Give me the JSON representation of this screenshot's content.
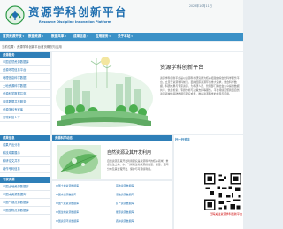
{
  "header": {
    "title": "资源学科创新平台",
    "subtitle": "Resource Discipline Innovation Platform",
    "date": "2023年10月11日"
  },
  "nav": [
    "首页资源开放",
    "数据资源",
    "数据共享",
    "成果信息",
    "应用服务",
    "关于本站"
  ],
  "breadcrumb": "当前位置：资源学科创新平台首页概况与应用",
  "sidebar": {
    "heading": "资源服务",
    "items": [
      "中国自然资源数据库",
      "资源环境信息平台",
      "地理信息科学数据",
      "土地资源科学数据",
      "资源科学数据共享",
      "遥感数据共享服务",
      "资源学科专家库",
      "高端科技人才"
    ],
    "heading2": "成果信息",
    "items2": [
      "成果产出分析",
      "科技成果展示",
      "科研论文共享",
      "著作专利信息",
      "人才培养情况"
    ],
    "heading3": "专家资源",
    "items3": [
      "中国土地资源数据库",
      "中国水资源数据库",
      "中国气候资源数据库",
      "中国生物资源数据库"
    ]
  },
  "main": {
    "platform_title": "资源学科创新平台",
    "platform_desc": "资源学科创新平台是以资源科学研究所为核心组建的综合性科学服务平台，立足于资源学科前沿，面向国家资源环境重大需求，整合科学数据、科研成果与专家资源，为科研人员、管理部门和社会公众提供数据共享、信息检索、专题分析与决策支持等服务。平台持续汇聚我国自然资源领域的基础数据与研究成果，推动资源科学的发展与应用。"
  },
  "news": {
    "heading": "资源科学动态",
    "title": "自然资源及其开发利用",
    "text": "自然资源及其开发利用研究是资源科学的核心领域，重点关注土地、水、气候和生物资源的数量、质量、空间分布及其合理开发、保护与可持续利用。"
  },
  "qr": {
    "title": "扫一扫关注",
    "caption": "扫码关注资源学科创新平台"
  },
  "links": {
    "col1": [
      "中国土地资源数据库",
      "中国水资源数据库",
      "中国气候资源数据库",
      "中国生物资源数据库",
      "中国资源环境数据库"
    ],
    "col2": [
      "草地资源数据库",
      "湿地资源数据库",
      "矿产资源数据库",
      "能源资源数据库",
      "森林资源数据库"
    ]
  },
  "colors": {
    "accent": "#2e7fb8",
    "nav": "#3b91c7",
    "title": "#1f6fb0"
  }
}
